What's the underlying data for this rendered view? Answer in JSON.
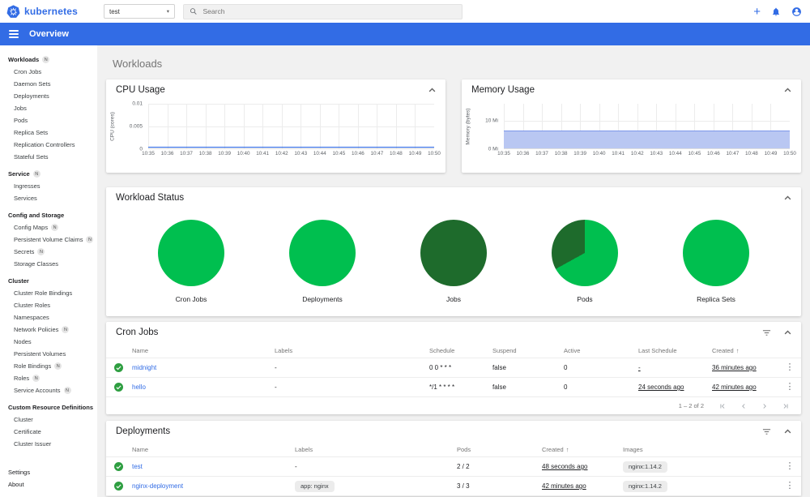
{
  "colors": {
    "brand_blue": "#326ce5",
    "green_bright": "#00bf4f",
    "green_dark": "#1e6b2c",
    "check_green": "#2e9e41",
    "memory_fill": "#b9c7f2"
  },
  "header": {
    "brand": "kubernetes",
    "namespace": "test",
    "search_placeholder": "Search"
  },
  "toolbar": {
    "title": "Overview"
  },
  "sidebar": {
    "groups": [
      {
        "label": "Workloads",
        "badge": "N",
        "children": [
          {
            "label": "Cron Jobs"
          },
          {
            "label": "Daemon Sets"
          },
          {
            "label": "Deployments"
          },
          {
            "label": "Jobs"
          },
          {
            "label": "Pods"
          },
          {
            "label": "Replica Sets"
          },
          {
            "label": "Replication Controllers"
          },
          {
            "label": "Stateful Sets"
          }
        ]
      },
      {
        "label": "Service",
        "badge": "N",
        "children": [
          {
            "label": "Ingresses"
          },
          {
            "label": "Services"
          }
        ]
      },
      {
        "label": "Config and Storage",
        "children": [
          {
            "label": "Config Maps",
            "badge": "N"
          },
          {
            "label": "Persistent Volume Claims",
            "badge": "N"
          },
          {
            "label": "Secrets",
            "badge": "N"
          },
          {
            "label": "Storage Classes"
          }
        ]
      },
      {
        "label": "Cluster",
        "children": [
          {
            "label": "Cluster Role Bindings"
          },
          {
            "label": "Cluster Roles"
          },
          {
            "label": "Namespaces"
          },
          {
            "label": "Network Policies",
            "badge": "N"
          },
          {
            "label": "Nodes"
          },
          {
            "label": "Persistent Volumes"
          },
          {
            "label": "Role Bindings",
            "badge": "N"
          },
          {
            "label": "Roles",
            "badge": "N"
          },
          {
            "label": "Service Accounts",
            "badge": "N"
          }
        ]
      },
      {
        "label": "Custom Resource Definitions",
        "children": [
          {
            "label": "Cluster"
          },
          {
            "label": "Certificate"
          },
          {
            "label": "Cluster Issuer"
          }
        ]
      }
    ],
    "footer": [
      {
        "label": "Settings"
      },
      {
        "label": "About"
      }
    ]
  },
  "page": {
    "title": "Workloads"
  },
  "charts": {
    "cpu": {
      "title": "CPU Usage",
      "type": "line",
      "ylabel": "CPU (cores)",
      "ylim": [
        0,
        0.01
      ],
      "yticks": [
        {
          "label": "0.01",
          "value": 0.01
        },
        {
          "label": "0.005",
          "value": 0.005
        },
        {
          "label": "0",
          "value": 0
        }
      ],
      "x": [
        "10:35",
        "10:36",
        "10:37",
        "10:38",
        "10:39",
        "10:40",
        "10:41",
        "10:42",
        "10:43",
        "10:44",
        "10:45",
        "10:46",
        "10:47",
        "10:48",
        "10:49",
        "10:50"
      ],
      "values": [
        0.0004,
        0.0004,
        0.0004,
        0.0004,
        0.0004,
        0.0004,
        0.0004,
        0.0004,
        0.0004,
        0.0004,
        0.0004,
        0.0004,
        0.0004,
        0.0004,
        0.0004,
        0.0004
      ]
    },
    "memory": {
      "title": "Memory Usage",
      "type": "area",
      "ylabel": "Memory (bytes)",
      "ylim": [
        0,
        16
      ],
      "unit": "Mi",
      "yticks": [
        {
          "label": "10 Mi",
          "value": 10
        },
        {
          "label": "0 Mi",
          "value": 0
        }
      ],
      "x": [
        "10:35",
        "10:36",
        "10:37",
        "10:38",
        "10:39",
        "10:40",
        "10:41",
        "10:42",
        "10:43",
        "10:44",
        "10:45",
        "10:46",
        "10:47",
        "10:48",
        "10:49",
        "10:50"
      ],
      "values": [
        6.5,
        6.5,
        6.5,
        6.5,
        6.5,
        6.5,
        6.5,
        6.5,
        6.5,
        6.5,
        6.5,
        6.5,
        6.5,
        6.5,
        6.5,
        6.5
      ]
    }
  },
  "workload_status": {
    "title": "Workload Status",
    "donuts": [
      {
        "label": "Cron Jobs",
        "segments": [
          {
            "color": "green_bright",
            "pct": 100
          }
        ]
      },
      {
        "label": "Deployments",
        "segments": [
          {
            "color": "green_bright",
            "pct": 100
          }
        ]
      },
      {
        "label": "Jobs",
        "segments": [
          {
            "color": "green_dark",
            "pct": 100
          }
        ]
      },
      {
        "label": "Pods",
        "segments": [
          {
            "color": "green_bright",
            "pct": 67
          },
          {
            "color": "green_dark",
            "pct": 33
          }
        ]
      },
      {
        "label": "Replica Sets",
        "segments": [
          {
            "color": "green_bright",
            "pct": 100
          }
        ]
      }
    ]
  },
  "cron_jobs": {
    "title": "Cron Jobs",
    "columns": [
      "Name",
      "Labels",
      "Schedule",
      "Suspend",
      "Active",
      "Last Schedule",
      "Created"
    ],
    "sort_column": "Created",
    "rows": [
      {
        "name": "midnight",
        "labels": [],
        "schedule": "0 0 * * *",
        "suspend": "false",
        "active": "0",
        "last_schedule": "-",
        "created": "36 minutes ago"
      },
      {
        "name": "hello",
        "labels": [],
        "schedule": "*/1 * * * *",
        "suspend": "false",
        "active": "0",
        "last_schedule": "24 seconds ago",
        "created": "42 minutes ago"
      }
    ],
    "pagination": {
      "range_label": "1 – 2 of 2"
    }
  },
  "deployments": {
    "title": "Deployments",
    "columns": [
      "Name",
      "Labels",
      "Pods",
      "Created",
      "Images"
    ],
    "sort_column": "Created",
    "rows": [
      {
        "name": "test",
        "labels": [],
        "pods": "2 / 2",
        "created": "48 seconds ago",
        "images": [
          "nginx:1.14.2"
        ]
      },
      {
        "name": "nginx-deployment",
        "labels": [
          "app: nginx"
        ],
        "pods": "3 / 3",
        "created": "42 minutes ago",
        "images": [
          "nginx:1.14.2"
        ]
      }
    ]
  }
}
